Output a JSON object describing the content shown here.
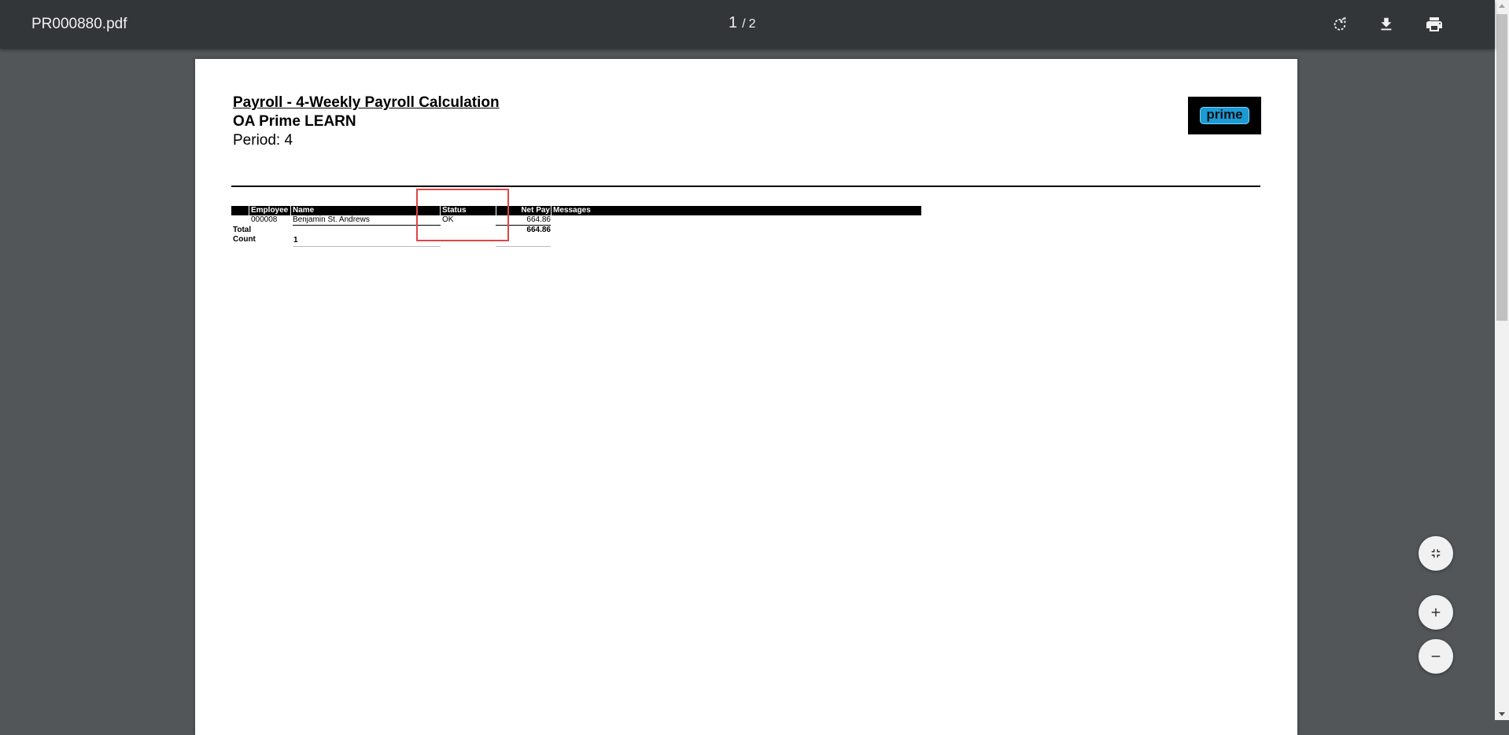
{
  "viewer": {
    "file_name": "PR000880.pdf",
    "current_page": "1",
    "page_separator": "/",
    "total_pages": "2",
    "rotate_icon": "rotate-icon",
    "download_icon": "download-icon",
    "print_icon": "print-icon",
    "fit_icon": "fit-to-page-icon",
    "zoom_in_icon": "plus-icon",
    "zoom_out_icon": "minus-icon"
  },
  "document": {
    "title": "Payroll - 4-Weekly Payroll Calculation",
    "company": "OA Prime LEARN",
    "period": "Period: 4",
    "logo_text": "prime",
    "table": {
      "columns": [
        "Employee",
        "Name",
        "Status",
        "Net Pay",
        "Messages"
      ],
      "rows": [
        {
          "employee": "000008",
          "name": "Benjamin St. Andrews",
          "status": "OK",
          "net_pay": "664.86",
          "messages": ""
        }
      ],
      "total_label": "Total",
      "total_net_pay": "664.86",
      "count_label": "Count",
      "count_value": "1"
    }
  },
  "colors": {
    "toolbar": "#323639",
    "background": "#525659",
    "highlight": "#e04646",
    "logo_accent": "#1c9ad6"
  }
}
